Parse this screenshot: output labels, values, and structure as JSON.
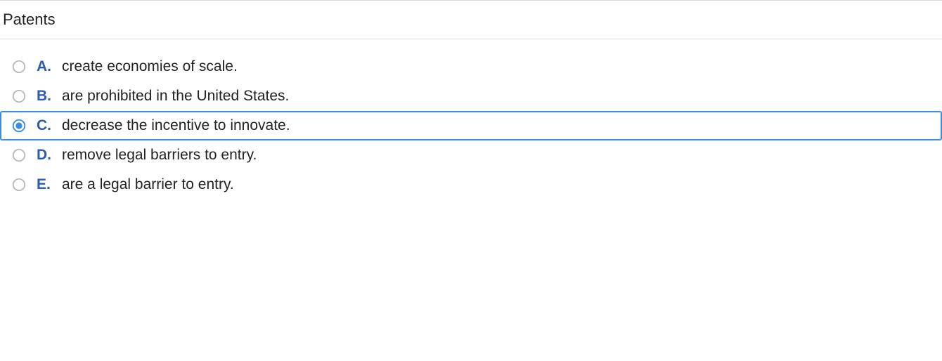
{
  "question": {
    "prompt": "Patents"
  },
  "options": [
    {
      "letter": "A.",
      "text": "create economies of scale.",
      "selected": false
    },
    {
      "letter": "B.",
      "text": "are prohibited in the United States.",
      "selected": false
    },
    {
      "letter": "C.",
      "text": "decrease the incentive to innovate.",
      "selected": true
    },
    {
      "letter": "D.",
      "text": "remove legal barriers to entry.",
      "selected": false
    },
    {
      "letter": "E.",
      "text": "are a legal barrier to entry.",
      "selected": false
    }
  ]
}
